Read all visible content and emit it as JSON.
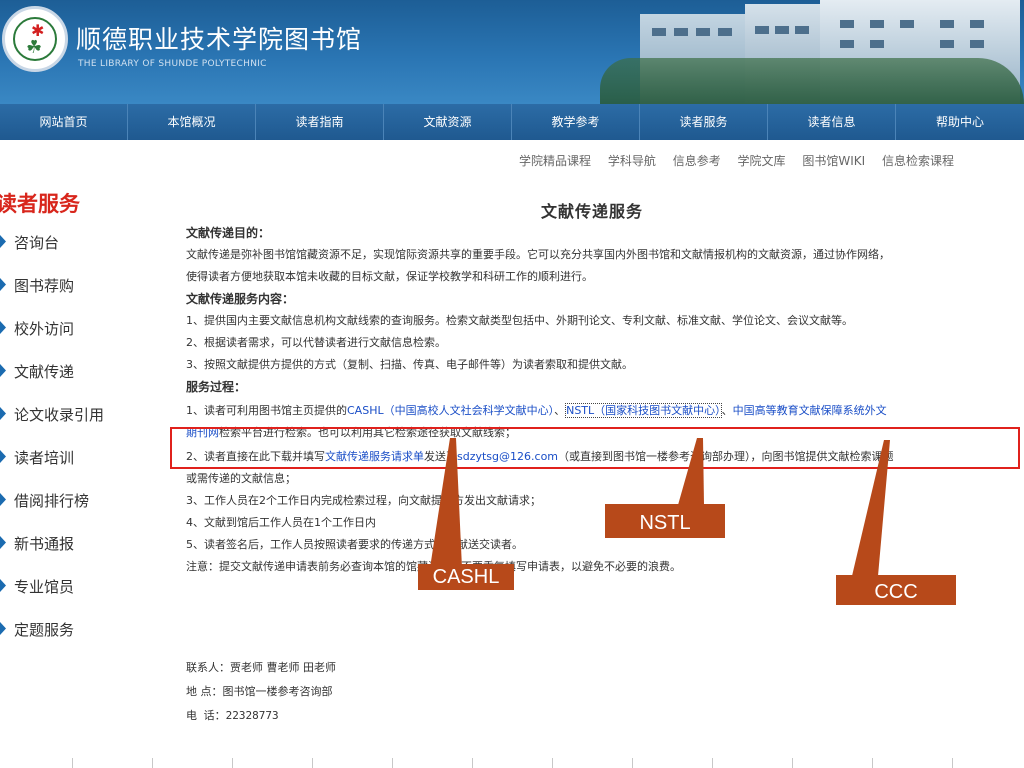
{
  "header": {
    "title": "顺德职业技术学院图书馆",
    "subtitle": "THE LIBRARY OF SHUNDE POLYTECHNIC"
  },
  "nav": [
    "网站首页",
    "本馆概况",
    "读者指南",
    "文献资源",
    "教学参考",
    "读者服务",
    "读者信息",
    "帮助中心"
  ],
  "sub_links": [
    "学院精品课程",
    "学科导航",
    "信息参考",
    "学院文库",
    "图书馆WIKI",
    "信息检索课程"
  ],
  "sidebar": {
    "title": "读者服务",
    "items": [
      "咨询台",
      "图书荐购",
      "校外访问",
      "文献传递",
      "论文收录引用",
      "读者培训",
      "借阅排行榜",
      "新书通报",
      "专业馆员",
      "定题服务"
    ]
  },
  "content": {
    "title": "文献传递服务",
    "purpose_heading": "文献传递目的：",
    "purpose_1": "文献传递是弥补图书馆馆藏资源不足，实现馆际资源共享的重要手段。它可以充分共享国内外图书馆和文献情报机构的文献资源，通过协作网络，",
    "purpose_2": "使得读者方便地获取本馆未收藏的目标文献，保证学校教学和科研工作的顺利进行。",
    "scope_heading": "文献传递服务内容：",
    "scope_1": "1、提供国内主要文献信息机构文献线索的查询服务。检索文献类型包括中、外期刊论文、专利文献、标准文献、学位论文、会议文献等。",
    "scope_2": "2、根据读者需求，可以代替读者进行文献信息检索。",
    "scope_3": "3、按照文献提供方提供的方式（复制、扫描、传真、电子邮件等）为读者索取和提供文献。",
    "process_heading": "服务过程：",
    "p1_a": "1、读者可利用图书馆主页提供的",
    "p1_cashl": "CASHL（中国高校人文社会科学文献中心）",
    "p1_sep1": "、",
    "p1_nstl": "NSTL（国家科技图书文献中心）",
    "p1_sep2": "、",
    "p1_ccc": "中国高等教育文献保障系统外文",
    "p1_ccc2": "期刊网",
    "p1_b": "检索平台进行检索。也可以利用其它检索途径获取文献线索；",
    "p2_a": "2、读者直接在此下载并填写",
    "p2_link": "文献传递服务请求单",
    "p2_b": "发送至",
    "p2_email": "sdzytsg@126.com",
    "p2_c": "（或直接到图书馆一楼参考咨询部办理），向图书馆提供文献检索课题",
    "p2_d": "或需传递的文献信息；",
    "p3": "3、工作人员在2个工作日内完成检索过程，向文献提供方发出文献请求；",
    "p4": "4、文献到馆后工作人员在1个工作日内",
    "p5": "5、读者签名后，工作人员按照读者要求的传递方式将文献送交读者。",
    "note": "注意：提交文献传递申请表前务必查询本馆的馆藏资源，不要重复填写申请表，以避免不必要的浪费。"
  },
  "contact": {
    "people": "联系人：贾老师 曹老师 田老师",
    "place": "地 点：图书馆一楼参考咨询部",
    "phone": "电 话：22328773"
  },
  "annotations": {
    "cashl": "CASHL",
    "nstl": "NSTL",
    "ccc": "CCC",
    "color": "#b7491a",
    "box_color": "#e0211c"
  }
}
